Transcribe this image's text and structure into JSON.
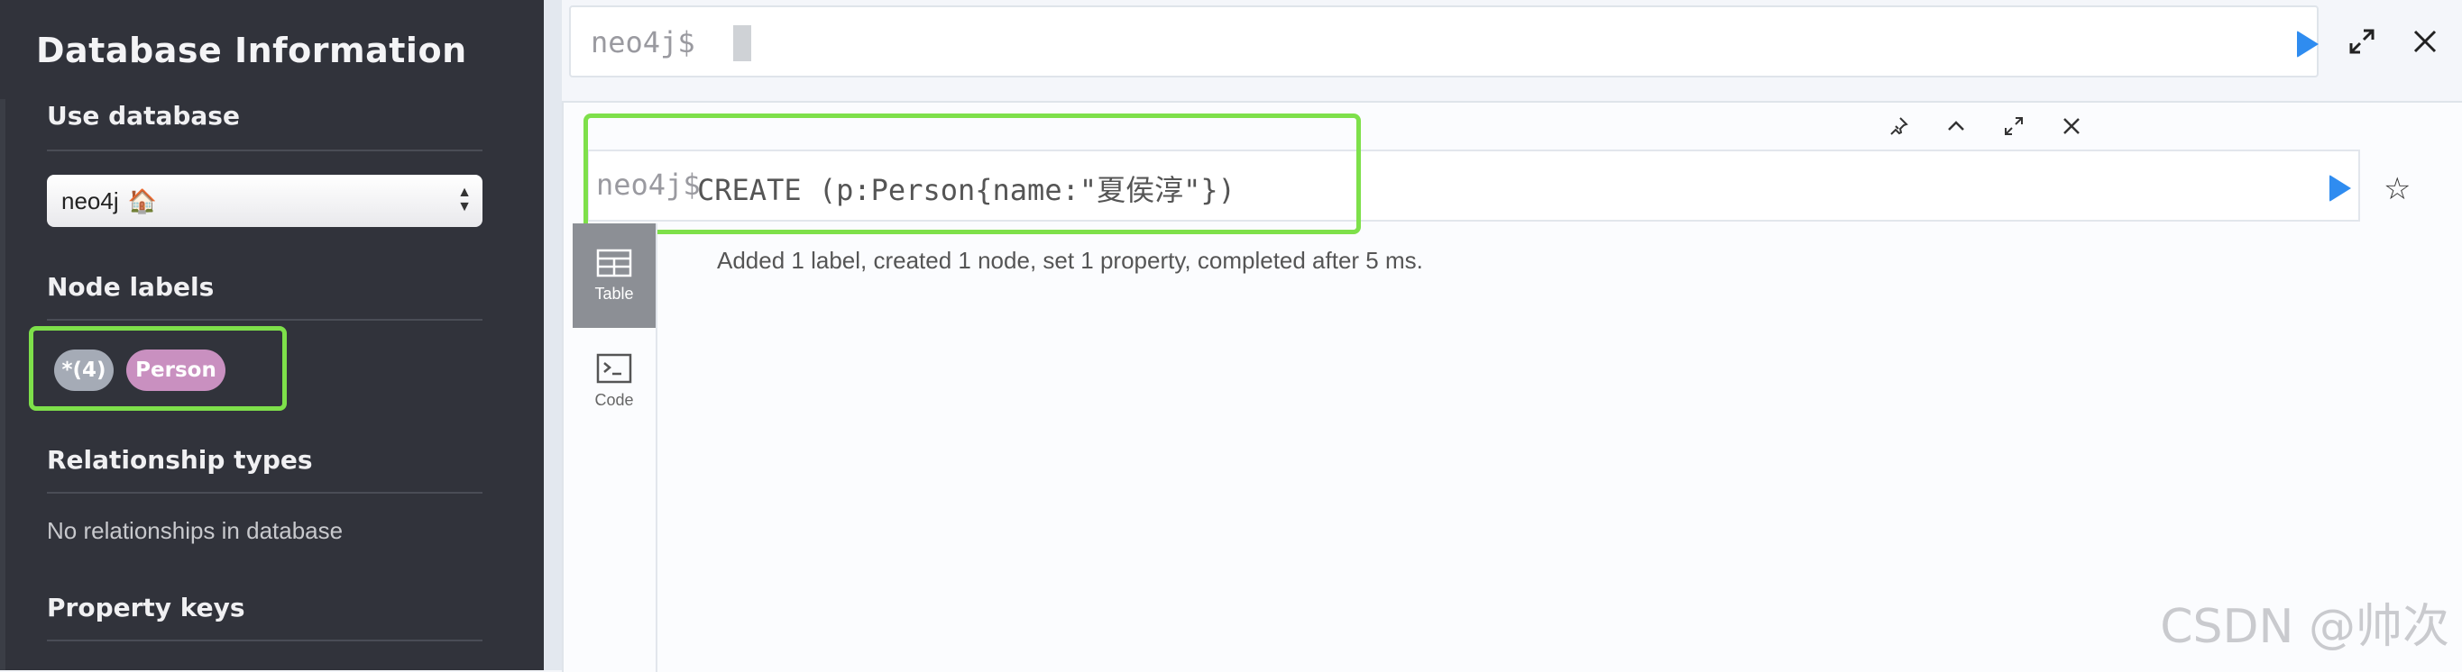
{
  "sidebar": {
    "title": "Database Information",
    "use_database": {
      "heading": "Use database",
      "selected": "neo4j",
      "selected_icon": "home-icon"
    },
    "node_labels": {
      "heading": "Node labels",
      "items": [
        "*(4)",
        "Person"
      ]
    },
    "relationship_types": {
      "heading": "Relationship types",
      "empty_text": "No relationships in database"
    },
    "property_keys": {
      "heading": "Property keys"
    }
  },
  "top_editor": {
    "prompt": "neo4j$",
    "run_icon": "play-icon",
    "expand_icon": "expand-icon",
    "close_icon": "close-icon"
  },
  "frame": {
    "prompt": "neo4j$",
    "query": "CREATE (p:Person{name:\"夏侯淳\"})",
    "controls": [
      "pin-icon",
      "collapse-icon",
      "fullscreen-icon",
      "close-icon"
    ],
    "tabs": [
      {
        "label": "Table",
        "icon": "table-icon",
        "active": true
      },
      {
        "label": "Code",
        "icon": "code-icon",
        "active": false
      }
    ],
    "result_message": "Added 1 label, created 1 node, set 1 property, completed after 5 ms."
  },
  "watermark": "CSDN @帅次",
  "colors": {
    "sidebar_bg": "#31333b",
    "highlight": "#7ee04a",
    "person_label": "#c990c0",
    "all_label": "#a5abb6",
    "run_button": "#2f8cf0"
  }
}
